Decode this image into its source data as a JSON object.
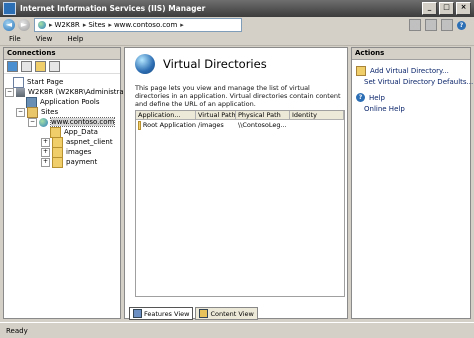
{
  "window": {
    "title": "Internet Information Services (IIS) Manager"
  },
  "address": {
    "crumbs": [
      "W2K8R",
      "Sites",
      "www.contoso.com"
    ]
  },
  "menu": [
    "File",
    "View",
    "Help"
  ],
  "connections": {
    "header": "Connections",
    "tree": [
      {
        "label": "Start Page",
        "icon": "page-icon"
      },
      {
        "label": "W2K8R (W2K8R\\Administrator)",
        "icon": "server-icon"
      },
      {
        "label": "Application Pools",
        "icon": "app-pools-icon"
      },
      {
        "label": "Sites",
        "icon": "sites-folder-icon"
      },
      {
        "label": "www.contoso.com",
        "icon": "globe-icon"
      },
      {
        "label": "App_Data",
        "icon": "folder-icon"
      },
      {
        "label": "aspnet_client",
        "icon": "folder-icon"
      },
      {
        "label": "images",
        "icon": "folder-icon"
      },
      {
        "label": "payment",
        "icon": "folder-icon"
      }
    ]
  },
  "main": {
    "title": "Virtual Directories",
    "description": "This page lets you view and manage the list of virtual directories in an application. Virtual directories contain content and define the URL of an application.",
    "columns": [
      "Application...",
      "Virtual Path",
      "Physical Path",
      "Identity"
    ],
    "rows": [
      [
        "Root Application",
        "/images",
        "\\\\ContosoLeg...",
        ""
      ]
    ],
    "tabs": [
      "Features View",
      "Content View"
    ]
  },
  "actions": {
    "header": "Actions",
    "items": [
      "Add Virtual Directory...",
      "Set Virtual Directory Defaults...",
      "Help",
      "Online Help"
    ]
  },
  "status": {
    "text": "Ready"
  }
}
